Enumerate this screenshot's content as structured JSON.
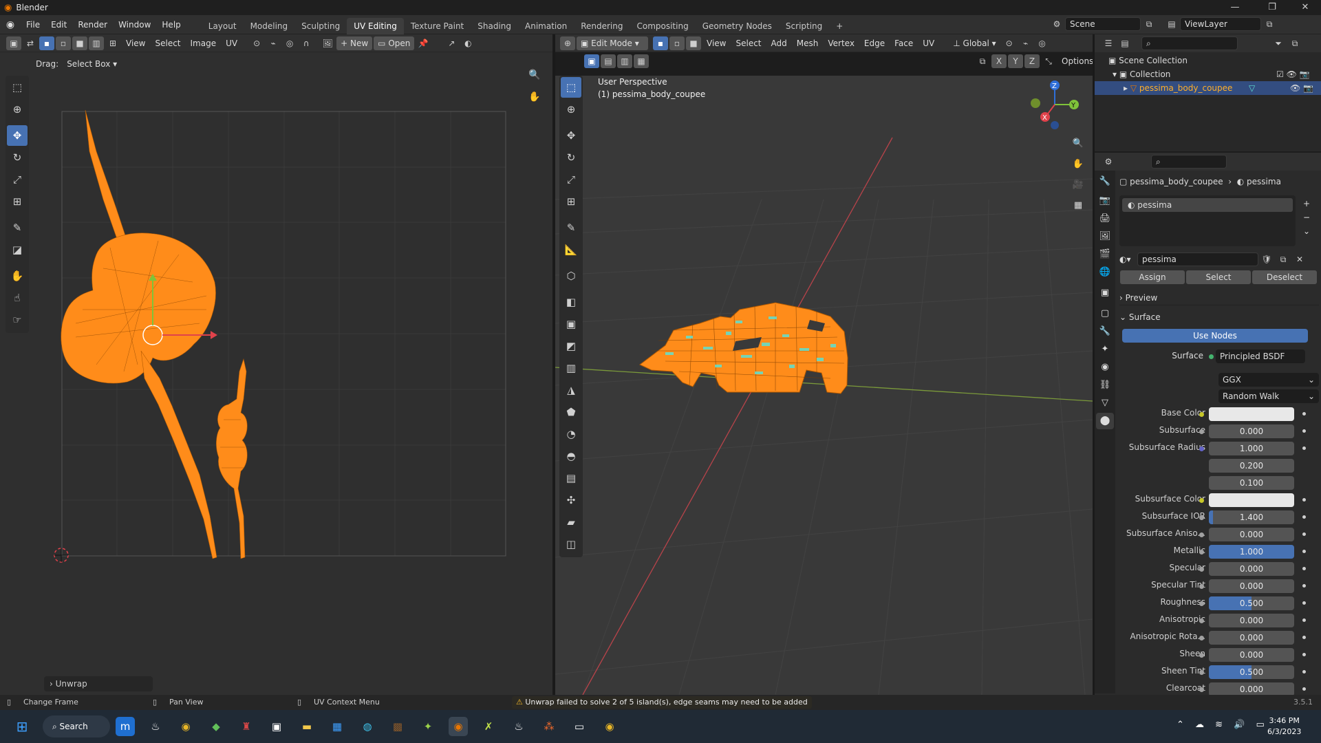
{
  "titlebar": {
    "title": "Blender",
    "minimize": "—",
    "maximize": "❐",
    "close": "✕"
  },
  "menus": [
    "File",
    "Edit",
    "Render",
    "Window",
    "Help"
  ],
  "workspaces": [
    "Layout",
    "Modeling",
    "Sculpting",
    "UV Editing",
    "Texture Paint",
    "Shading",
    "Animation",
    "Rendering",
    "Compositing",
    "Geometry Nodes",
    "Scripting"
  ],
  "workspace_add": "+",
  "scene": "Scene",
  "viewlayer": "ViewLayer",
  "uv_header": {
    "menus": [
      "View",
      "Select",
      "Image",
      "UV"
    ],
    "new_label": "New",
    "open_label": "Open"
  },
  "uv_tool_settings": {
    "drag_label": "Drag:",
    "drag_value": "Select Box"
  },
  "unwrap_panel": "Unwrap",
  "viewport_header": {
    "mode": "Edit Mode",
    "menus": [
      "View",
      "Select",
      "Add",
      "Mesh",
      "Vertex",
      "Edge",
      "Face",
      "UV"
    ],
    "transform": "Global",
    "options": "Options",
    "axes": [
      "X",
      "Y",
      "Z"
    ]
  },
  "viewport_overlay": {
    "line1": "User Perspective",
    "line2": "(1) pessima_body_coupee"
  },
  "gizmo": {
    "z": "Z",
    "y": "Y",
    "x": "X"
  },
  "outliner": {
    "scene_collection": "Scene Collection",
    "collection": "Collection",
    "object": "pessima_body_coupee"
  },
  "properties": {
    "breadcrumb_object": "pessima_body_coupee",
    "breadcrumb_material": "pessima",
    "slot_name": "pessima",
    "material_name": "pessima",
    "assign": "Assign",
    "select": "Select",
    "deselect": "Deselect",
    "preview": "Preview",
    "surface_panel": "Surface",
    "use_nodes": "Use Nodes",
    "surface_label": "Surface",
    "surface_value": "Principled BSDF",
    "distribution": "GGX",
    "subsurface_method": "Random Walk",
    "rows": [
      {
        "label": "Base Color",
        "value": "",
        "kind": "white",
        "dot": "#c7c729"
      },
      {
        "label": "Subsurface",
        "value": "0.000",
        "kind": "field",
        "dot": "#a1a1a1"
      },
      {
        "label": "Subsurface Radius",
        "value": "1.000",
        "kind": "field",
        "dot": "#6363c7"
      },
      {
        "label": "",
        "value": "0.200",
        "kind": "field",
        "dot": ""
      },
      {
        "label": "",
        "value": "0.100",
        "kind": "field",
        "dot": ""
      },
      {
        "label": "Subsurface Color",
        "value": "",
        "kind": "white",
        "dot": "#c7c729"
      },
      {
        "label": "Subsurface IOR",
        "value": "1.400",
        "kind": "fill",
        "fraction": 0.05,
        "dot": "#a1a1a1"
      },
      {
        "label": "Subsurface Aniso...",
        "value": "0.000",
        "kind": "field",
        "dot": "#a1a1a1"
      },
      {
        "label": "Metallic",
        "value": "1.000",
        "kind": "fill",
        "fraction": 1.0,
        "dot": "#a1a1a1"
      },
      {
        "label": "Specular",
        "value": "0.000",
        "kind": "field",
        "dot": "#a1a1a1"
      },
      {
        "label": "Specular Tint",
        "value": "0.000",
        "kind": "field",
        "dot": "#a1a1a1"
      },
      {
        "label": "Roughness",
        "value": "0.500",
        "kind": "fill",
        "fraction": 0.5,
        "dot": "#a1a1a1"
      },
      {
        "label": "Anisotropic",
        "value": "0.000",
        "kind": "field",
        "dot": "#a1a1a1"
      },
      {
        "label": "Anisotropic Rota...",
        "value": "0.000",
        "kind": "field",
        "dot": "#a1a1a1"
      },
      {
        "label": "Sheen",
        "value": "0.000",
        "kind": "field",
        "dot": "#a1a1a1"
      },
      {
        "label": "Sheen Tint",
        "value": "0.500",
        "kind": "fill",
        "fraction": 0.5,
        "dot": "#a1a1a1"
      },
      {
        "label": "Clearcoat",
        "value": "0.000",
        "kind": "field",
        "dot": "#a1a1a1"
      }
    ]
  },
  "statusbar": {
    "left1": "Change Frame",
    "left2": "Pan View",
    "left3": "UV Context Menu",
    "warning": "Unwrap failed to solve 2 of 5 island(s), edge seams may need to be added",
    "version": "3.5.1"
  },
  "taskbar": {
    "search": "Search",
    "time": "3:46 PM",
    "date": "6/3/2023"
  },
  "colors": {
    "accent": "#4772b3",
    "mesh": "#ff8c1a",
    "seam": "#5fe0d0",
    "warning": "#f2b72a"
  }
}
